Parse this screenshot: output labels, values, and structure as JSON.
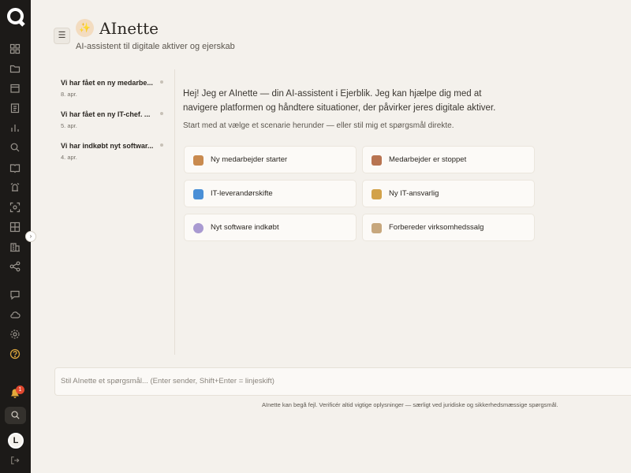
{
  "rail": {
    "badge_count": "1",
    "avatar_letter": "L",
    "icons": [
      "dashboard-icon",
      "folder-icon",
      "calendar-icon",
      "clipboard-icon",
      "bar-chart-icon",
      "search-icon",
      "book-icon",
      "bell-alarm-icon",
      "scan-icon",
      "grid-icon",
      "building-icon",
      "network-icon",
      "chat-icon",
      "cloud-icon",
      "settings-icon",
      "help-icon",
      "notification-bell-icon",
      "search-icon",
      "avatar",
      "logout-icon"
    ]
  },
  "header": {
    "menu_icon": "☰",
    "brand_icon": "✨",
    "title": "AInette",
    "subtitle": "AI-assistent til digitale aktiver og ejerskab"
  },
  "conversations": [
    {
      "title": "Vi har fået en ny medarbe...",
      "date": "8. apr."
    },
    {
      "title": "Vi har fået en ny IT-chef. ...",
      "date": "5. apr."
    },
    {
      "title": "Vi har indkøbt nyt softwar...",
      "date": "4. apr."
    }
  ],
  "main": {
    "intro": "Hej! Jeg er AInette — din AI-assistent i Ejerblik. Jeg kan hjælpe dig med at navigere platformen og håndtere situationer, der påvirker jeres digitale aktiver.",
    "hint": "Start med at vælge et scenarie herunder — eller stil mig et spørgsmål direkte.",
    "scenarios": [
      {
        "label": "Ny medarbejder starter",
        "icon": "person-icon",
        "color": "#c98a4e"
      },
      {
        "label": "Medarbejder er stoppet",
        "icon": "door-icon",
        "color": "#b87451"
      },
      {
        "label": "IT-leverandørskifte",
        "icon": "swap-icon",
        "color": "#4a8fd6"
      },
      {
        "label": "Ny IT-ansvarlig",
        "icon": "technician-icon",
        "color": "#d2a24a"
      },
      {
        "label": "Nyt software indkøbt",
        "icon": "disc-icon",
        "color": "#a99ad1"
      },
      {
        "label": "Forbereder virksomhedssalg",
        "icon": "clipboard-icon",
        "color": "#c7a77d"
      }
    ]
  },
  "composer": {
    "placeholder": "Stil AInette et spørgsmål... (Enter sender, Shift+Enter = linjeskift)",
    "value": ""
  },
  "disclaimer": "AInette kan begå fejl. Verificér altid vigtige oplysninger — særligt ved juridiske og sikkerhedsmæssige spørgsmål.",
  "colors": {
    "rail_bg": "#1c1a18",
    "page_bg": "#f4f1ec",
    "accent": "#d98c3a",
    "badge": "#e0482f"
  }
}
